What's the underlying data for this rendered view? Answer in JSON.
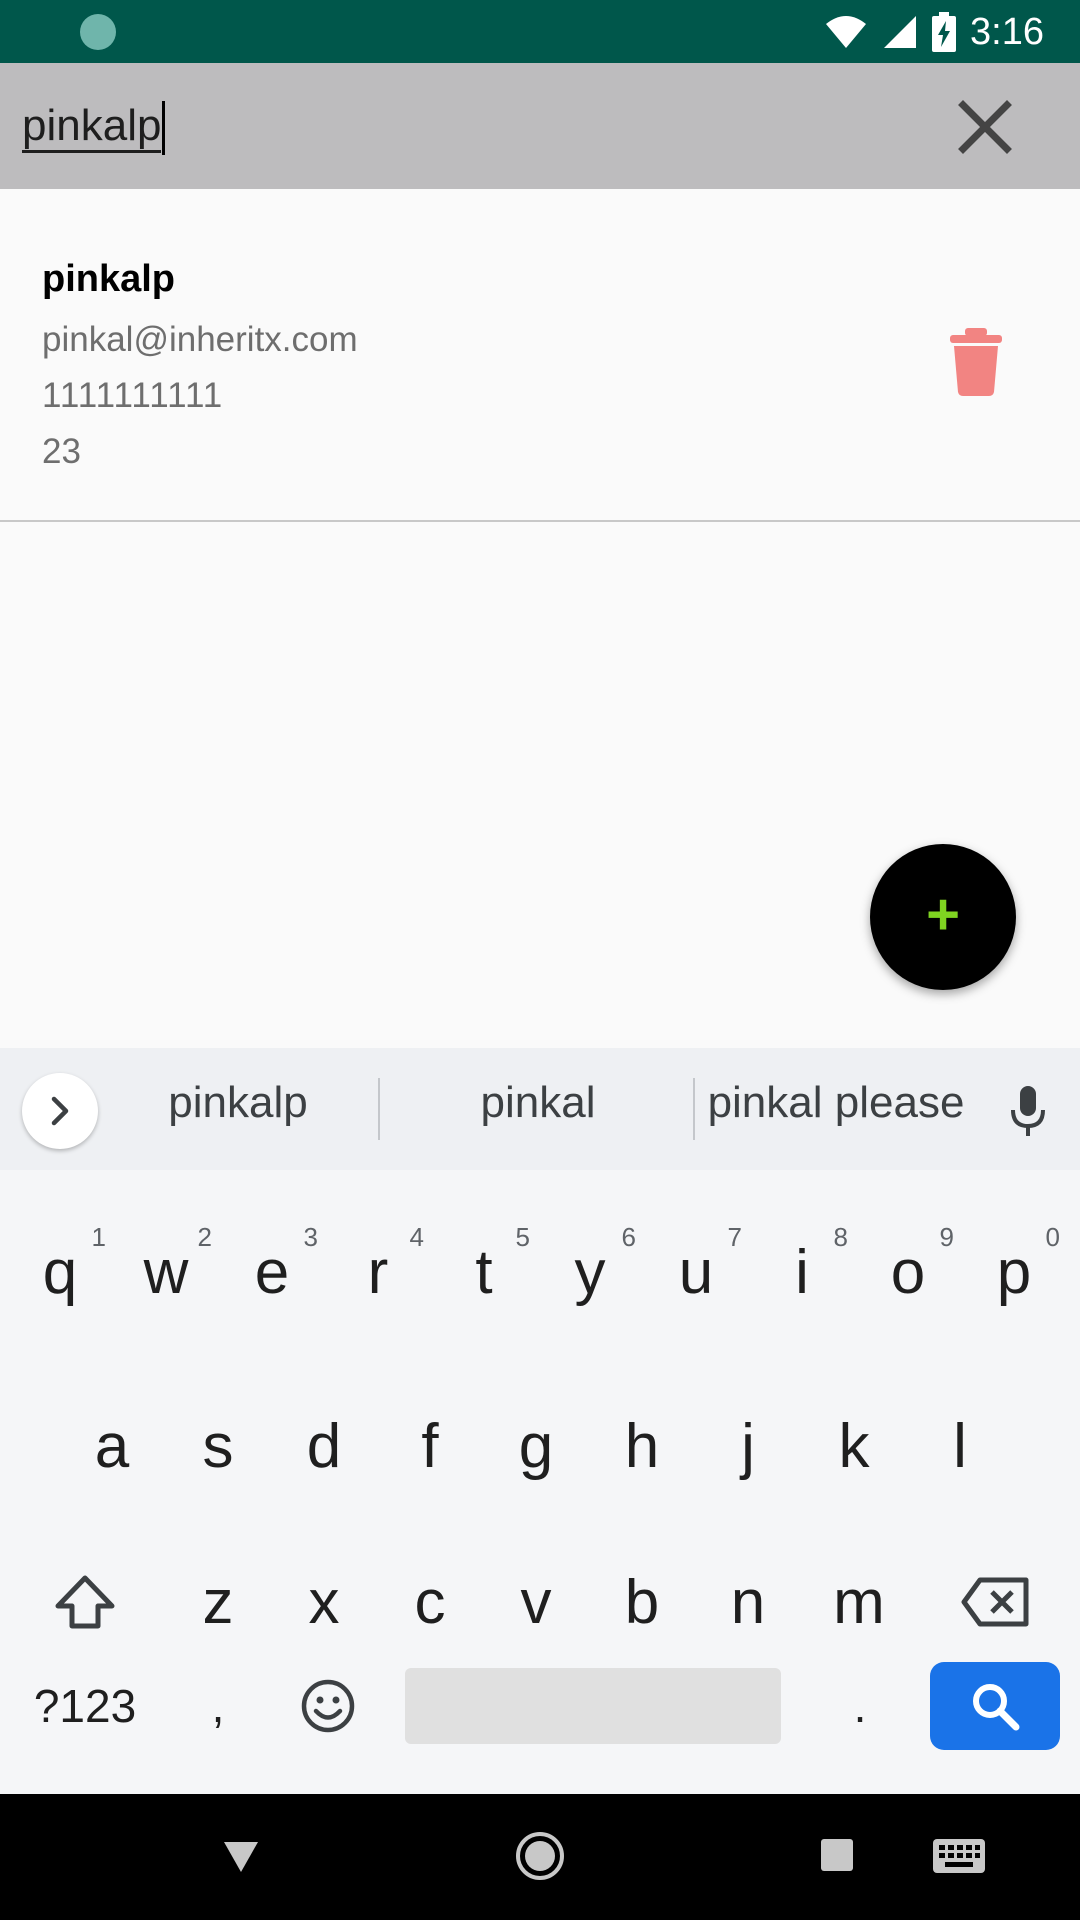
{
  "status_bar": {
    "time": "3:16",
    "icons": [
      "sync-icon",
      "wifi-icon",
      "signal-icon",
      "battery-charging-icon"
    ]
  },
  "search": {
    "query": "pinkalp",
    "clear_icon": "close-icon"
  },
  "results": [
    {
      "name": "pinkalp",
      "email": "pinkal@inheritx.com",
      "phone": "1111111111",
      "age": "23",
      "delete_icon": "trash-icon",
      "delete_color": "#f28482"
    }
  ],
  "fab": {
    "icon": "plus-icon",
    "icon_color": "#7fd321",
    "bg": "#000000"
  },
  "suggestions": [
    "pinkalp",
    "pinkal",
    "pinkal please"
  ],
  "keyboard": {
    "row1": [
      {
        "k": "q",
        "h": "1"
      },
      {
        "k": "w",
        "h": "2"
      },
      {
        "k": "e",
        "h": "3"
      },
      {
        "k": "r",
        "h": "4"
      },
      {
        "k": "t",
        "h": "5"
      },
      {
        "k": "y",
        "h": "6"
      },
      {
        "k": "u",
        "h": "7"
      },
      {
        "k": "i",
        "h": "8"
      },
      {
        "k": "o",
        "h": "9"
      },
      {
        "k": "p",
        "h": "0"
      }
    ],
    "row2": [
      "a",
      "s",
      "d",
      "f",
      "g",
      "h",
      "j",
      "k",
      "l"
    ],
    "row3": [
      "z",
      "x",
      "c",
      "v",
      "b",
      "n",
      "m"
    ],
    "symbols_key": "?123",
    "comma_key": ",",
    "period_key": ".",
    "action_color": "#1a73e8"
  },
  "nav_bar": {
    "icons": [
      "back-icon",
      "home-icon",
      "recents-icon",
      "keyboard-switch-icon"
    ]
  }
}
